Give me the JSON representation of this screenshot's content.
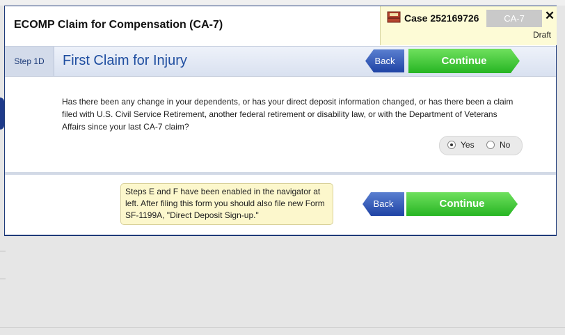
{
  "form": {
    "title": "ECOMP Claim for Compensation (CA-7)"
  },
  "case": {
    "label": "Case 252169726",
    "form_badge": "CA-7",
    "status": "Draft",
    "close_glyph": "✕"
  },
  "step": {
    "badge": "Step 1D",
    "title": "First Claim for Injury"
  },
  "buttons": {
    "back": "Back",
    "continue": "Continue"
  },
  "question": {
    "text": "Has there been any change in your dependents, or has your direct deposit information changed, or has there been a claim filed with U.S. Civil Service Retirement, another federal retirement or disability law, or with the Department of Veterans Affairs since your last CA-7 claim?",
    "options": [
      "Yes",
      "No"
    ],
    "selected": "Yes"
  },
  "note": {
    "text": "Steps E and F have been enabled in the navigator at left. After filing this form you should also file new Form SF-1199A, \"Direct Deposit Sign-up.\""
  },
  "colors": {
    "continue": "#27b523",
    "back": "#1f43a5",
    "step_title": "#1f4ea0",
    "note_bg": "#fcf7cc"
  },
  "icons": {
    "case": "case-folder-icon",
    "close": "close-icon"
  }
}
